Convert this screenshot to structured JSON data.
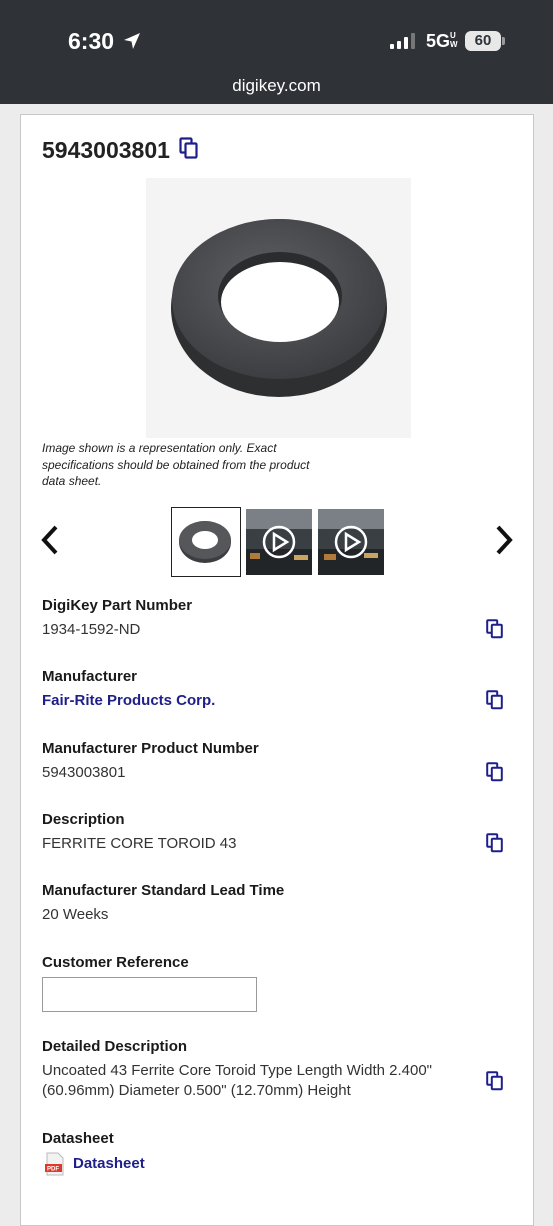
{
  "status_bar": {
    "time": "6:30",
    "network": "5G",
    "network_suffix": "UW",
    "battery": "60"
  },
  "browser": {
    "url": "digikey.com"
  },
  "product": {
    "title": "5943003801",
    "image_caption": "Image shown is a representation only. Exact specifications should be obtained from the product data sheet.",
    "fields": {
      "digikey_part_number": {
        "label": "DigiKey Part Number",
        "value": "1934-1592-ND"
      },
      "manufacturer": {
        "label": "Manufacturer",
        "value": "Fair-Rite Products Corp."
      },
      "manufacturer_product_number": {
        "label": "Manufacturer Product Number",
        "value": "5943003801"
      },
      "description": {
        "label": "Description",
        "value": "FERRITE CORE TOROID 43"
      },
      "lead_time": {
        "label": "Manufacturer Standard Lead Time",
        "value": "20 Weeks"
      },
      "customer_reference": {
        "label": "Customer Reference",
        "value": ""
      },
      "detailed_description": {
        "label": "Detailed Description",
        "value": "Uncoated 43 Ferrite Core Toroid Type Length Width 2.400\" (60.96mm) Diameter 0.500\" (12.70mm) Height"
      },
      "datasheet": {
        "label": "Datasheet",
        "link_text": "Datasheet"
      }
    }
  },
  "icons": {
    "copy": "copy-icon",
    "prev": "chevron-left-icon",
    "next": "chevron-right-icon",
    "play": "play-icon",
    "pdf": "pdf-icon",
    "location": "location-arrow-icon"
  },
  "colors": {
    "link": "#1f1f8a",
    "status_bar_bg": "#2f3237",
    "ferrite": "#4a4b4e"
  }
}
